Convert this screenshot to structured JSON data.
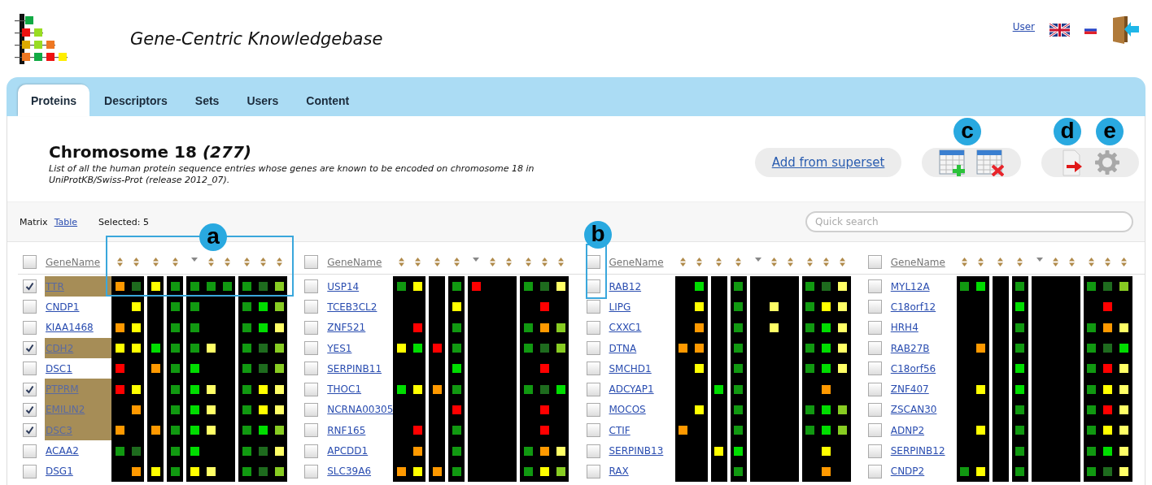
{
  "header": {
    "title": "Gene-Centric Knowledgebase",
    "user_link": "User"
  },
  "tabs": [
    {
      "label": "Proteins",
      "selected": true
    },
    {
      "label": "Descriptors",
      "selected": false
    },
    {
      "label": "Sets",
      "selected": false
    },
    {
      "label": "Users",
      "selected": false
    },
    {
      "label": "Content",
      "selected": false
    }
  ],
  "heading": {
    "title": "Chromosome 18 *(277)*",
    "description": "List of all the human protein sequence entries whose genes are known to be encoded on chromosome 18 in UniProtKB/Swiss-Prot (release 2012_07)."
  },
  "actions": {
    "add_from_superset": "Add from superset"
  },
  "action_callouts": [
    "c",
    "d",
    "e"
  ],
  "view_modes": [
    {
      "label": "Matrix",
      "selected": true
    },
    {
      "label": "Table",
      "selected": false
    }
  ],
  "selected_count": "Selected: 5",
  "search": {
    "placeholder": "Quick search"
  },
  "matrix_callouts": [
    "a",
    "b"
  ],
  "groups": [
    {
      "header": {
        "label": "GeneName",
        "checked": false
      },
      "sort_columns": [
        {
          "sorted": false
        },
        {
          "sorted": false
        },
        {
          "sorted": false
        },
        {
          "sorted": false
        },
        {
          "sorted": true
        },
        {
          "sorted": false
        },
        {
          "sorted": false
        },
        {
          "sorted": false
        },
        {
          "sorted": false
        },
        {
          "sorted": false
        }
      ],
      "rows": [
        {
          "name": "TTR",
          "checked": true,
          "cells": [
            {
              "kind": "mark",
              "color": "#ff9900"
            },
            {
              "kind": "mark",
              "color": "#1e6b1e"
            },
            {
              "kind": "mark",
              "color": "#ffff00"
            },
            {
              "kind": "mark",
              "color": "#119911"
            },
            {
              "kind": "mark",
              "color": "#119911"
            },
            {
              "kind": "mark",
              "color": "#119911"
            },
            {
              "kind": "mark",
              "color": "#119911"
            },
            {
              "kind": "mark",
              "color": "#119911"
            },
            {
              "kind": "mark",
              "color": "#1e6b1e"
            },
            {
              "kind": "mark",
              "color": "#88cc22"
            }
          ]
        },
        {
          "name": "CNDP1",
          "checked": false,
          "cells": [
            {
              "kind": "blank"
            },
            {
              "kind": "mark",
              "color": "#ffff00"
            },
            {
              "kind": "blank"
            },
            {
              "kind": "mark",
              "color": "#119911"
            },
            {
              "kind": "mark",
              "color": "#119911"
            },
            {
              "kind": "blank"
            },
            {
              "kind": "blank"
            },
            {
              "kind": "mark",
              "color": "#119911"
            },
            {
              "kind": "mark",
              "color": "#00dd00"
            },
            {
              "kind": "mark",
              "color": "#88cc22"
            }
          ]
        },
        {
          "name": "KIAA1468",
          "checked": false,
          "cells": [
            {
              "kind": "mark",
              "color": "#ff9900"
            },
            {
              "kind": "mark",
              "color": "#ffff00"
            },
            {
              "kind": "blank"
            },
            {
              "kind": "mark",
              "color": "#119911"
            },
            {
              "kind": "mark",
              "color": "#119911"
            },
            {
              "kind": "blank"
            },
            {
              "kind": "blank"
            },
            {
              "kind": "mark",
              "color": "#119911"
            },
            {
              "kind": "mark",
              "color": "#00dd00"
            },
            {
              "kind": "mark",
              "color": "#ffff66"
            }
          ]
        },
        {
          "name": "CDH2",
          "checked": true,
          "cells": [
            {
              "kind": "mark",
              "color": "#ffff00"
            },
            {
              "kind": "mark",
              "color": "#ffff00"
            },
            {
              "kind": "mark",
              "color": "#00dd00"
            },
            {
              "kind": "mark",
              "color": "#119911"
            },
            {
              "kind": "mark",
              "color": "#119911"
            },
            {
              "kind": "mark",
              "color": "#ffff66"
            },
            {
              "kind": "blank"
            },
            {
              "kind": "mark",
              "color": "#119911"
            },
            {
              "kind": "mark",
              "color": "#1e6b1e"
            },
            {
              "kind": "mark",
              "color": "#88cc22"
            }
          ]
        },
        {
          "name": "DSC1",
          "checked": false,
          "cells": [
            {
              "kind": "mark",
              "color": "#ff0000"
            },
            {
              "kind": "blank"
            },
            {
              "kind": "mark",
              "color": "#ff9900"
            },
            {
              "kind": "mark",
              "color": "#119911"
            },
            {
              "kind": "mark",
              "color": "#00dd00"
            },
            {
              "kind": "blank"
            },
            {
              "kind": "blank"
            },
            {
              "kind": "mark",
              "color": "#119911"
            },
            {
              "kind": "mark",
              "color": "#1e6b1e"
            },
            {
              "kind": "mark",
              "color": "#88cc22"
            }
          ]
        },
        {
          "name": "PTPRM",
          "checked": true,
          "cells": [
            {
              "kind": "mark",
              "color": "#ff0000"
            },
            {
              "kind": "mark",
              "color": "#ffff00"
            },
            {
              "kind": "blank"
            },
            {
              "kind": "mark",
              "color": "#119911"
            },
            {
              "kind": "mark",
              "color": "#00dd00"
            },
            {
              "kind": "mark",
              "color": "#ffff66"
            },
            {
              "kind": "blank"
            },
            {
              "kind": "mark",
              "color": "#119911"
            },
            {
              "kind": "mark",
              "color": "#ffff00"
            },
            {
              "kind": "mark",
              "color": "#ffff66"
            }
          ]
        },
        {
          "name": "EMILIN2",
          "checked": true,
          "cells": [
            {
              "kind": "blank"
            },
            {
              "kind": "mark",
              "color": "#ff9900"
            },
            {
              "kind": "blank"
            },
            {
              "kind": "mark",
              "color": "#119911"
            },
            {
              "kind": "mark",
              "color": "#00dd00"
            },
            {
              "kind": "mark",
              "color": "#ffff66"
            },
            {
              "kind": "blank"
            },
            {
              "kind": "mark",
              "color": "#119911"
            },
            {
              "kind": "mark",
              "color": "#ffff00"
            },
            {
              "kind": "mark",
              "color": "#ffff66"
            }
          ]
        },
        {
          "name": "DSC3",
          "checked": true,
          "cells": [
            {
              "kind": "mark",
              "color": "#ff9900"
            },
            {
              "kind": "blank"
            },
            {
              "kind": "mark",
              "color": "#ff9900"
            },
            {
              "kind": "mark",
              "color": "#119911"
            },
            {
              "kind": "mark",
              "color": "#00dd00"
            },
            {
              "kind": "mark",
              "color": "#ffff66"
            },
            {
              "kind": "blank"
            },
            {
              "kind": "mark",
              "color": "#119911"
            },
            {
              "kind": "mark",
              "color": "#00dd00"
            },
            {
              "kind": "mark",
              "color": "#88cc22"
            }
          ]
        },
        {
          "name": "ACAA2",
          "checked": false,
          "cells": [
            {
              "kind": "mark",
              "color": "#119911"
            },
            {
              "kind": "mark",
              "color": "#1e6b1e"
            },
            {
              "kind": "blank"
            },
            {
              "kind": "mark",
              "color": "#119911"
            },
            {
              "kind": "mark",
              "color": "#00dd00"
            },
            {
              "kind": "blank"
            },
            {
              "kind": "blank"
            },
            {
              "kind": "mark",
              "color": "#119911"
            },
            {
              "kind": "mark",
              "color": "#1e6b1e"
            },
            {
              "kind": "mark",
              "color": "#ffff66"
            }
          ]
        },
        {
          "name": "DSG1",
          "checked": false,
          "cells": [
            {
              "kind": "blank"
            },
            {
              "kind": "mark",
              "color": "#ff9900"
            },
            {
              "kind": "mark",
              "color": "#ffff00"
            },
            {
              "kind": "mark",
              "color": "#119911"
            },
            {
              "kind": "mark",
              "color": "#ffff00"
            },
            {
              "kind": "mark",
              "color": "#ffff66"
            },
            {
              "kind": "blank"
            },
            {
              "kind": "mark",
              "color": "#119911"
            },
            {
              "kind": "mark",
              "color": "#1e6b1e"
            },
            {
              "kind": "mark",
              "color": "#88cc22"
            }
          ]
        }
      ]
    },
    {
      "header": {
        "label": "GeneName",
        "checked": false
      },
      "sort_columns": [
        {
          "sorted": false
        },
        {
          "sorted": false
        },
        {
          "sorted": false
        },
        {
          "sorted": false
        },
        {
          "sorted": true
        },
        {
          "sorted": false
        },
        {
          "sorted": false
        },
        {
          "sorted": false
        },
        {
          "sorted": false
        },
        {
          "sorted": false
        }
      ],
      "rows": [
        {
          "name": "USP14",
          "checked": false,
          "cells": [
            {
              "kind": "mark",
              "color": "#119911"
            },
            {
              "kind": "mark",
              "color": "#ffff00"
            },
            {
              "kind": "blank"
            },
            {
              "kind": "mark",
              "color": "#119911"
            },
            {
              "kind": "mark",
              "color": "#ff0000"
            },
            {
              "kind": "blank"
            },
            {
              "kind": "blank"
            },
            {
              "kind": "mark",
              "color": "#119911"
            },
            {
              "kind": "mark",
              "color": "#1e6b1e"
            },
            {
              "kind": "mark",
              "color": "#ffff66"
            }
          ]
        },
        {
          "name": "TCEB3CL2",
          "checked": false,
          "cells": [
            {
              "kind": "blank"
            },
            {
              "kind": "blank"
            },
            {
              "kind": "blank"
            },
            {
              "kind": "mark",
              "color": "#ffff00"
            },
            {
              "kind": "blank"
            },
            {
              "kind": "blank"
            },
            {
              "kind": "blank"
            },
            {
              "kind": "blank"
            },
            {
              "kind": "mark",
              "color": "#ff0000"
            },
            {
              "kind": "blank"
            }
          ]
        },
        {
          "name": "ZNF521",
          "checked": false,
          "cells": [
            {
              "kind": "blank"
            },
            {
              "kind": "mark",
              "color": "#ff0000"
            },
            {
              "kind": "blank"
            },
            {
              "kind": "mark",
              "color": "#119911"
            },
            {
              "kind": "blank"
            },
            {
              "kind": "blank"
            },
            {
              "kind": "blank"
            },
            {
              "kind": "mark",
              "color": "#119911"
            },
            {
              "kind": "mark",
              "color": "#ff9900"
            },
            {
              "kind": "mark",
              "color": "#88cc22"
            }
          ]
        },
        {
          "name": "YES1",
          "checked": false,
          "cells": [
            {
              "kind": "mark",
              "color": "#ffff00"
            },
            {
              "kind": "mark",
              "color": "#00dd00"
            },
            {
              "kind": "mark",
              "color": "#ff0000"
            },
            {
              "kind": "mark",
              "color": "#119911"
            },
            {
              "kind": "blank"
            },
            {
              "kind": "blank"
            },
            {
              "kind": "blank"
            },
            {
              "kind": "mark",
              "color": "#119911"
            },
            {
              "kind": "mark",
              "color": "#1e6b1e"
            },
            {
              "kind": "mark",
              "color": "#88cc22"
            }
          ]
        },
        {
          "name": "SERPINB11",
          "checked": false,
          "cells": [
            {
              "kind": "blank"
            },
            {
              "kind": "blank"
            },
            {
              "kind": "blank"
            },
            {
              "kind": "mark",
              "color": "#00dd00"
            },
            {
              "kind": "blank"
            },
            {
              "kind": "blank"
            },
            {
              "kind": "blank"
            },
            {
              "kind": "blank"
            },
            {
              "kind": "mark",
              "color": "#ff0000"
            },
            {
              "kind": "blank"
            }
          ]
        },
        {
          "name": "THOC1",
          "checked": false,
          "cells": [
            {
              "kind": "mark",
              "color": "#00dd00"
            },
            {
              "kind": "mark",
              "color": "#ffff00"
            },
            {
              "kind": "mark",
              "color": "#ff9900"
            },
            {
              "kind": "mark",
              "color": "#119911"
            },
            {
              "kind": "blank"
            },
            {
              "kind": "blank"
            },
            {
              "kind": "blank"
            },
            {
              "kind": "mark",
              "color": "#119911"
            },
            {
              "kind": "mark",
              "color": "#1e6b1e"
            },
            {
              "kind": "mark",
              "color": "#00dd00"
            }
          ]
        },
        {
          "name": "NCRNA00305",
          "checked": false,
          "cells": [
            {
              "kind": "blank"
            },
            {
              "kind": "blank"
            },
            {
              "kind": "blank"
            },
            {
              "kind": "mark",
              "color": "#ff0000"
            },
            {
              "kind": "blank"
            },
            {
              "kind": "blank"
            },
            {
              "kind": "blank"
            },
            {
              "kind": "blank"
            },
            {
              "kind": "mark",
              "color": "#ff0000"
            },
            {
              "kind": "blank"
            }
          ]
        },
        {
          "name": "RNF165",
          "checked": false,
          "cells": [
            {
              "kind": "blank"
            },
            {
              "kind": "mark",
              "color": "#ff0000"
            },
            {
              "kind": "blank"
            },
            {
              "kind": "mark",
              "color": "#119911"
            },
            {
              "kind": "blank"
            },
            {
              "kind": "blank"
            },
            {
              "kind": "blank"
            },
            {
              "kind": "blank"
            },
            {
              "kind": "mark",
              "color": "#ff0000"
            },
            {
              "kind": "blank"
            }
          ]
        },
        {
          "name": "APCDD1",
          "checked": false,
          "cells": [
            {
              "kind": "blank"
            },
            {
              "kind": "mark",
              "color": "#ff9900"
            },
            {
              "kind": "blank"
            },
            {
              "kind": "mark",
              "color": "#119911"
            },
            {
              "kind": "blank"
            },
            {
              "kind": "blank"
            },
            {
              "kind": "blank"
            },
            {
              "kind": "mark",
              "color": "#119911"
            },
            {
              "kind": "mark",
              "color": "#ff9900"
            },
            {
              "kind": "mark",
              "color": "#ffff66"
            }
          ]
        },
        {
          "name": "SLC39A6",
          "checked": false,
          "cells": [
            {
              "kind": "mark",
              "color": "#ff9900"
            },
            {
              "kind": "mark",
              "color": "#ffff00"
            },
            {
              "kind": "mark",
              "color": "#ff9900"
            },
            {
              "kind": "mark",
              "color": "#119911"
            },
            {
              "kind": "blank"
            },
            {
              "kind": "blank"
            },
            {
              "kind": "blank"
            },
            {
              "kind": "mark",
              "color": "#119911"
            },
            {
              "kind": "mark",
              "color": "#ffff00"
            },
            {
              "kind": "mark",
              "color": "#88cc22"
            }
          ]
        }
      ]
    },
    {
      "header": {
        "label": "GeneName",
        "checked": false
      },
      "sort_columns": [
        {
          "sorted": false
        },
        {
          "sorted": false
        },
        {
          "sorted": false
        },
        {
          "sorted": false
        },
        {
          "sorted": true
        },
        {
          "sorted": false
        },
        {
          "sorted": false
        },
        {
          "sorted": false
        },
        {
          "sorted": false
        },
        {
          "sorted": false
        }
      ],
      "rows": [
        {
          "name": "RAB12",
          "checked": false,
          "cells": [
            {
              "kind": "blank"
            },
            {
              "kind": "mark",
              "color": "#00dd00"
            },
            {
              "kind": "blank"
            },
            {
              "kind": "mark",
              "color": "#119911"
            },
            {
              "kind": "blank"
            },
            {
              "kind": "blank"
            },
            {
              "kind": "blank"
            },
            {
              "kind": "mark",
              "color": "#119911"
            },
            {
              "kind": "mark",
              "color": "#1e6b1e"
            },
            {
              "kind": "mark",
              "color": "#ffff66"
            }
          ]
        },
        {
          "name": "LIPG",
          "checked": false,
          "cells": [
            {
              "kind": "blank"
            },
            {
              "kind": "mark",
              "color": "#ffff00"
            },
            {
              "kind": "blank"
            },
            {
              "kind": "mark",
              "color": "#119911"
            },
            {
              "kind": "blank"
            },
            {
              "kind": "mark",
              "color": "#ffff66"
            },
            {
              "kind": "blank"
            },
            {
              "kind": "mark",
              "color": "#119911"
            },
            {
              "kind": "mark",
              "color": "#ffff00"
            },
            {
              "kind": "mark",
              "color": "#ffff66"
            }
          ]
        },
        {
          "name": "CXXC1",
          "checked": false,
          "cells": [
            {
              "kind": "blank"
            },
            {
              "kind": "mark",
              "color": "#ff9900"
            },
            {
              "kind": "blank"
            },
            {
              "kind": "mark",
              "color": "#119911"
            },
            {
              "kind": "blank"
            },
            {
              "kind": "mark",
              "color": "#ffff66"
            },
            {
              "kind": "blank"
            },
            {
              "kind": "mark",
              "color": "#119911"
            },
            {
              "kind": "mark",
              "color": "#00dd00"
            },
            {
              "kind": "mark",
              "color": "#ffff66"
            }
          ]
        },
        {
          "name": "DTNA",
          "checked": false,
          "cells": [
            {
              "kind": "mark",
              "color": "#ff9900"
            },
            {
              "kind": "mark",
              "color": "#ff9900"
            },
            {
              "kind": "blank"
            },
            {
              "kind": "mark",
              "color": "#119911"
            },
            {
              "kind": "blank"
            },
            {
              "kind": "blank"
            },
            {
              "kind": "blank"
            },
            {
              "kind": "mark",
              "color": "#119911"
            },
            {
              "kind": "mark",
              "color": "#00dd00"
            },
            {
              "kind": "mark",
              "color": "#ffff66"
            }
          ]
        },
        {
          "name": "SMCHD1",
          "checked": false,
          "cells": [
            {
              "kind": "blank"
            },
            {
              "kind": "mark",
              "color": "#ffff00"
            },
            {
              "kind": "blank"
            },
            {
              "kind": "mark",
              "color": "#119911"
            },
            {
              "kind": "blank"
            },
            {
              "kind": "blank"
            },
            {
              "kind": "blank"
            },
            {
              "kind": "mark",
              "color": "#119911"
            },
            {
              "kind": "mark",
              "color": "#00dd00"
            },
            {
              "kind": "mark",
              "color": "#ffff66"
            }
          ]
        },
        {
          "name": "ADCYAP1",
          "checked": false,
          "cells": [
            {
              "kind": "blank"
            },
            {
              "kind": "blank"
            },
            {
              "kind": "mark",
              "color": "#00dd00"
            },
            {
              "kind": "mark",
              "color": "#119911"
            },
            {
              "kind": "blank"
            },
            {
              "kind": "blank"
            },
            {
              "kind": "blank"
            },
            {
              "kind": "blank"
            },
            {
              "kind": "mark",
              "color": "#ff9900"
            },
            {
              "kind": "blank"
            }
          ]
        },
        {
          "name": "MOCOS",
          "checked": false,
          "cells": [
            {
              "kind": "blank"
            },
            {
              "kind": "mark",
              "color": "#ffff00"
            },
            {
              "kind": "blank"
            },
            {
              "kind": "mark",
              "color": "#119911"
            },
            {
              "kind": "blank"
            },
            {
              "kind": "blank"
            },
            {
              "kind": "blank"
            },
            {
              "kind": "mark",
              "color": "#119911"
            },
            {
              "kind": "mark",
              "color": "#00dd00"
            },
            {
              "kind": "mark",
              "color": "#88cc22"
            }
          ]
        },
        {
          "name": "CTIF",
          "checked": false,
          "cells": [
            {
              "kind": "mark",
              "color": "#ff9900"
            },
            {
              "kind": "blank"
            },
            {
              "kind": "blank"
            },
            {
              "kind": "mark",
              "color": "#119911"
            },
            {
              "kind": "blank"
            },
            {
              "kind": "blank"
            },
            {
              "kind": "blank"
            },
            {
              "kind": "mark",
              "color": "#119911"
            },
            {
              "kind": "mark",
              "color": "#00dd00"
            },
            {
              "kind": "mark",
              "color": "#88cc22"
            }
          ]
        },
        {
          "name": "SERPINB13",
          "checked": false,
          "cells": [
            {
              "kind": "blank"
            },
            {
              "kind": "blank"
            },
            {
              "kind": "mark",
              "color": "#ffff00"
            },
            {
              "kind": "mark",
              "color": "#00dd00"
            },
            {
              "kind": "blank"
            },
            {
              "kind": "blank"
            },
            {
              "kind": "blank"
            },
            {
              "kind": "blank"
            },
            {
              "kind": "mark",
              "color": "#ffff00"
            },
            {
              "kind": "blank"
            }
          ]
        },
        {
          "name": "RAX",
          "checked": false,
          "cells": [
            {
              "kind": "blank"
            },
            {
              "kind": "blank"
            },
            {
              "kind": "blank"
            },
            {
              "kind": "mark",
              "color": "#119911"
            },
            {
              "kind": "blank"
            },
            {
              "kind": "blank"
            },
            {
              "kind": "blank"
            },
            {
              "kind": "blank"
            },
            {
              "kind": "mark",
              "color": "#ff9900"
            },
            {
              "kind": "blank"
            }
          ]
        }
      ]
    },
    {
      "header": {
        "label": "GeneName",
        "checked": false
      },
      "sort_columns": [
        {
          "sorted": false
        },
        {
          "sorted": false
        },
        {
          "sorted": false
        },
        {
          "sorted": false
        },
        {
          "sorted": true
        },
        {
          "sorted": false
        },
        {
          "sorted": false
        },
        {
          "sorted": false
        },
        {
          "sorted": false
        },
        {
          "sorted": false
        }
      ],
      "rows": [
        {
          "name": "MYL12A",
          "checked": false,
          "cells": [
            {
              "kind": "mark",
              "color": "#119911"
            },
            {
              "kind": "mark",
              "color": "#00dd00"
            },
            {
              "kind": "blank"
            },
            {
              "kind": "mark",
              "color": "#119911"
            },
            {
              "kind": "blank"
            },
            {
              "kind": "blank"
            },
            {
              "kind": "blank"
            },
            {
              "kind": "mark",
              "color": "#119911"
            },
            {
              "kind": "mark",
              "color": "#1e6b1e"
            },
            {
              "kind": "mark",
              "color": "#88cc22"
            }
          ]
        },
        {
          "name": "C18orf12",
          "checked": false,
          "cells": [
            {
              "kind": "blank"
            },
            {
              "kind": "blank"
            },
            {
              "kind": "blank"
            },
            {
              "kind": "mark",
              "color": "#00dd00"
            },
            {
              "kind": "blank"
            },
            {
              "kind": "blank"
            },
            {
              "kind": "blank"
            },
            {
              "kind": "blank"
            },
            {
              "kind": "mark",
              "color": "#ff0000"
            },
            {
              "kind": "blank"
            }
          ]
        },
        {
          "name": "HRH4",
          "checked": false,
          "cells": [
            {
              "kind": "blank"
            },
            {
              "kind": "blank"
            },
            {
              "kind": "blank"
            },
            {
              "kind": "mark",
              "color": "#119911"
            },
            {
              "kind": "blank"
            },
            {
              "kind": "blank"
            },
            {
              "kind": "blank"
            },
            {
              "kind": "mark",
              "color": "#119911"
            },
            {
              "kind": "mark",
              "color": "#ff9900"
            },
            {
              "kind": "mark",
              "color": "#ffff66"
            }
          ]
        },
        {
          "name": "RAB27B",
          "checked": false,
          "cells": [
            {
              "kind": "blank"
            },
            {
              "kind": "mark",
              "color": "#ff9900"
            },
            {
              "kind": "blank"
            },
            {
              "kind": "mark",
              "color": "#119911"
            },
            {
              "kind": "blank"
            },
            {
              "kind": "blank"
            },
            {
              "kind": "blank"
            },
            {
              "kind": "mark",
              "color": "#119911"
            },
            {
              "kind": "mark",
              "color": "#1e6b1e"
            },
            {
              "kind": "mark",
              "color": "#00dd00"
            }
          ]
        },
        {
          "name": "C18orf56",
          "checked": false,
          "cells": [
            {
              "kind": "blank"
            },
            {
              "kind": "blank"
            },
            {
              "kind": "blank"
            },
            {
              "kind": "mark",
              "color": "#00dd00"
            },
            {
              "kind": "blank"
            },
            {
              "kind": "blank"
            },
            {
              "kind": "blank"
            },
            {
              "kind": "mark",
              "color": "#119911"
            },
            {
              "kind": "mark",
              "color": "#ff0000"
            },
            {
              "kind": "mark",
              "color": "#ffff66"
            }
          ]
        },
        {
          "name": "ZNF407",
          "checked": false,
          "cells": [
            {
              "kind": "blank"
            },
            {
              "kind": "mark",
              "color": "#ffff00"
            },
            {
              "kind": "blank"
            },
            {
              "kind": "mark",
              "color": "#00dd00"
            },
            {
              "kind": "blank"
            },
            {
              "kind": "blank"
            },
            {
              "kind": "blank"
            },
            {
              "kind": "mark",
              "color": "#119911"
            },
            {
              "kind": "mark",
              "color": "#ffff00"
            },
            {
              "kind": "mark",
              "color": "#ffff66"
            }
          ]
        },
        {
          "name": "ZSCAN30",
          "checked": false,
          "cells": [
            {
              "kind": "blank"
            },
            {
              "kind": "blank"
            },
            {
              "kind": "blank"
            },
            {
              "kind": "mark",
              "color": "#119911"
            },
            {
              "kind": "blank"
            },
            {
              "kind": "blank"
            },
            {
              "kind": "blank"
            },
            {
              "kind": "mark",
              "color": "#119911"
            },
            {
              "kind": "mark",
              "color": "#ff0000"
            },
            {
              "kind": "mark",
              "color": "#ffff66"
            }
          ]
        },
        {
          "name": "ADNP2",
          "checked": false,
          "cells": [
            {
              "kind": "blank"
            },
            {
              "kind": "mark",
              "color": "#ffff00"
            },
            {
              "kind": "blank"
            },
            {
              "kind": "mark",
              "color": "#119911"
            },
            {
              "kind": "blank"
            },
            {
              "kind": "blank"
            },
            {
              "kind": "blank"
            },
            {
              "kind": "mark",
              "color": "#119911"
            },
            {
              "kind": "mark",
              "color": "#ffff00"
            },
            {
              "kind": "mark",
              "color": "#ffff66"
            }
          ]
        },
        {
          "name": "SERPINB12",
          "checked": false,
          "cells": [
            {
              "kind": "blank"
            },
            {
              "kind": "blank"
            },
            {
              "kind": "blank"
            },
            {
              "kind": "mark",
              "color": "#119911"
            },
            {
              "kind": "blank"
            },
            {
              "kind": "blank"
            },
            {
              "kind": "blank"
            },
            {
              "kind": "mark",
              "color": "#119911"
            },
            {
              "kind": "mark",
              "color": "#00dd00"
            },
            {
              "kind": "mark",
              "color": "#ffff66"
            }
          ]
        },
        {
          "name": "CNDP2",
          "checked": false,
          "cells": [
            {
              "kind": "mark",
              "color": "#119911"
            },
            {
              "kind": "mark",
              "color": "#ffff00"
            },
            {
              "kind": "blank"
            },
            {
              "kind": "mark",
              "color": "#119911"
            },
            {
              "kind": "blank"
            },
            {
              "kind": "blank"
            },
            {
              "kind": "blank"
            },
            {
              "kind": "mark",
              "color": "#119911"
            },
            {
              "kind": "mark",
              "color": "#1e6b1e"
            },
            {
              "kind": "mark",
              "color": "#ffff66"
            }
          ]
        }
      ]
    }
  ]
}
